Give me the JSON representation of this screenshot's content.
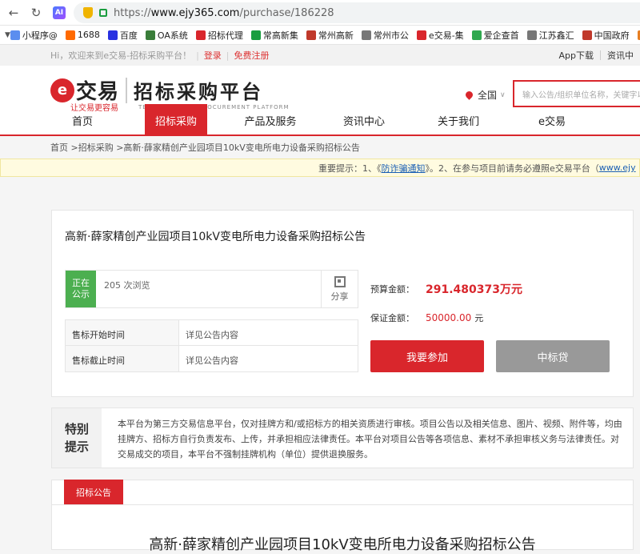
{
  "browser": {
    "url_prefix": "https://",
    "url_host": "www.ejy365.com",
    "url_path": "/purchase/186228",
    "ai_label": "AI",
    "bookmarks": [
      {
        "label": "小程序@",
        "color": "#5b8def"
      },
      {
        "label": "1688",
        "color": "#ff6a00"
      },
      {
        "label": "百度",
        "color": "#2932e1"
      },
      {
        "label": "OA系统",
        "color": "#3a7d3a"
      },
      {
        "label": "招标代理",
        "color": "#d9262c"
      },
      {
        "label": "常高新集",
        "color": "#1a9d3f"
      },
      {
        "label": "常州高新",
        "color": "#c0392b"
      },
      {
        "label": "常州市公",
        "color": "#777777"
      },
      {
        "label": "e交易-集",
        "color": "#d9262c"
      },
      {
        "label": "爱企查首",
        "color": "#2fa84f"
      },
      {
        "label": "江苏鑫汇",
        "color": "#777777"
      },
      {
        "label": "中国政府",
        "color": "#c0392b"
      },
      {
        "label": "常州市全",
        "color": "#e67e22"
      }
    ]
  },
  "topbar": {
    "welcome": "Hi，欢迎来到e交易-招标采购平台！",
    "login": "登录",
    "register": "免费注册",
    "app": "App下载",
    "info": "资讯中"
  },
  "header": {
    "logo_mark": "e",
    "logo_name": "交易",
    "logo_slogan": "让交易更容易",
    "platform_title": "招标采购平台",
    "platform_en": "TENDERING AND PROCUREMENT PLATFORM",
    "region": "全国",
    "search_placeholder": "输入公告/组织单位名称，关键字以"
  },
  "nav": {
    "items": [
      "首页",
      "招标采购",
      "产品及服务",
      "资讯中心",
      "关于我们",
      "e交易"
    ],
    "active_index": 1
  },
  "breadcrumb": "首页 >招标采购 >高新·薛家精创产业园项目10kV变电所电力设备采购招标公告",
  "notice": {
    "prefix": "重要提示：1、《",
    "link": "防诈骗通知",
    "middle": "》。2、在参与项目前请务必遵照e交易平台（",
    "link2": "www.ejy"
  },
  "project": {
    "title": "高新·薛家精创产业园项目10kV变电所电力设备采购招标公告",
    "status": "正在公示",
    "views": "205 次浏览",
    "share": "分享",
    "sale_start_label": "售标开始时间",
    "sale_start_value": "详见公告内容",
    "sale_end_label": "售标截止时间",
    "sale_end_value": "详见公告内容",
    "budget_label": "预算金额：",
    "budget_value": "291.480373万元",
    "deposit_label": "保证金额：",
    "deposit_value": "50000.00",
    "deposit_unit": "元",
    "join_button": "我要参加",
    "loan_button": "中标贷"
  },
  "tip": {
    "label": "特别提示",
    "text": "本平台为第三方交易信息平台，仅对挂牌方和/或招标方的相关资质进行审核。项目公告以及相关信息、图片、视频、附件等，均由挂牌方、招标方自行负责发布、上传，并承担相应法律责任。本平台对项目公告等各项信息、素材不承担审核义务与法律责任。对交易成交的项目，本平台不强制挂牌机构（单位）提供退换服务。"
  },
  "announcement": {
    "tab": "招标公告",
    "title": "高新·薛家精创产业园项目10kV变电所电力设备采购招标公告"
  }
}
